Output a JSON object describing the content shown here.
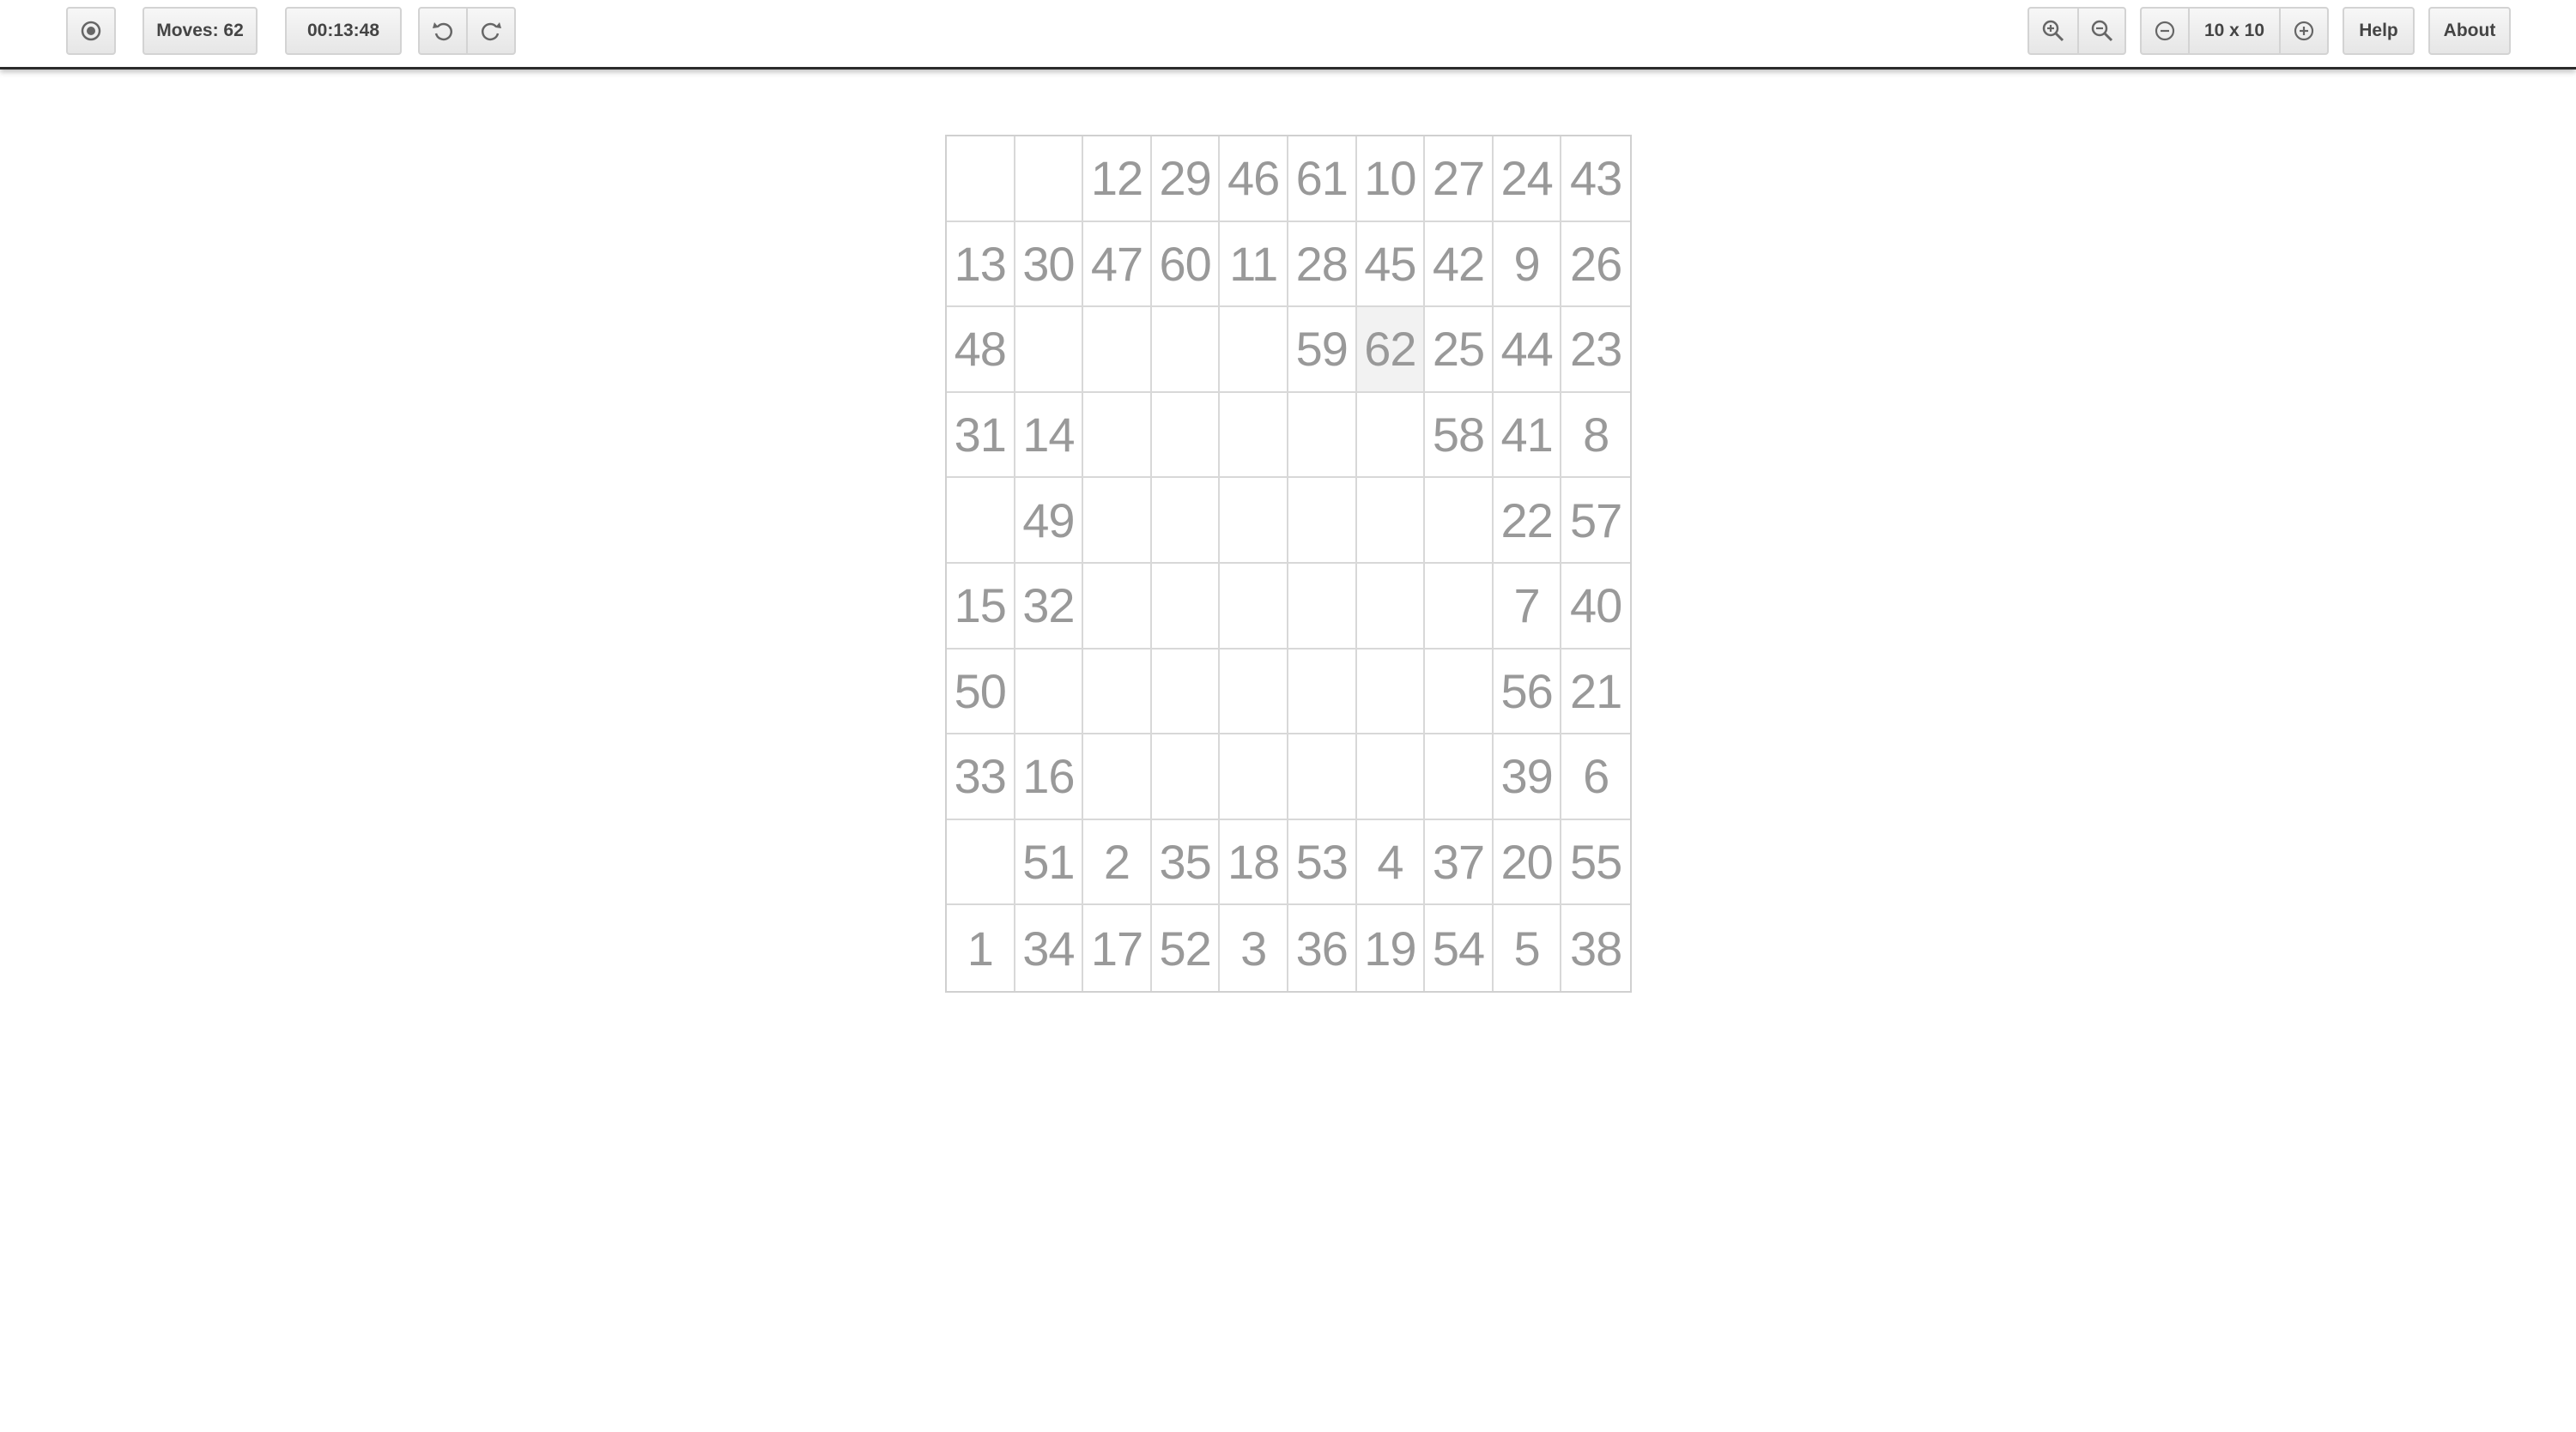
{
  "toolbar": {
    "moves_label": "Moves: 62",
    "timer": "00:13:48",
    "size_label": "10 x 10",
    "help_label": "Help",
    "about_label": "About",
    "icons": {
      "menu": "record-icon",
      "undo": "undo-icon",
      "redo": "redo-icon",
      "zoom_in": "zoom-in-icon",
      "zoom_out": "zoom-out-icon",
      "decrease": "minus-circle-icon",
      "increase": "plus-circle-icon"
    }
  },
  "board": {
    "rows": 10,
    "cols": 10,
    "current_value": "62",
    "cells": [
      [
        "",
        "",
        "12",
        "29",
        "46",
        "61",
        "10",
        "27",
        "24",
        "43"
      ],
      [
        "13",
        "30",
        "47",
        "60",
        "11",
        "28",
        "45",
        "42",
        "9",
        "26"
      ],
      [
        "48",
        "",
        "",
        "",
        "",
        "59",
        "62",
        "25",
        "44",
        "23"
      ],
      [
        "31",
        "14",
        "",
        "",
        "",
        "",
        "",
        "58",
        "41",
        "8"
      ],
      [
        "",
        "49",
        "",
        "",
        "",
        "",
        "",
        "",
        "22",
        "57"
      ],
      [
        "15",
        "32",
        "",
        "",
        "",
        "",
        "",
        "",
        "7",
        "40"
      ],
      [
        "50",
        "",
        "",
        "",
        "",
        "",
        "",
        "",
        "56",
        "21"
      ],
      [
        "33",
        "16",
        "",
        "",
        "",
        "",
        "",
        "",
        "39",
        "6"
      ],
      [
        "",
        "51",
        "2",
        "35",
        "18",
        "53",
        "4",
        "37",
        "20",
        "55"
      ],
      [
        "1",
        "34",
        "17",
        "52",
        "3",
        "36",
        "19",
        "54",
        "5",
        "38"
      ]
    ]
  },
  "colors": {
    "number": "#999999",
    "grid_line": "#d8d8d8",
    "toolbar_border": "#2b2b2b",
    "button_text": "#444444"
  }
}
